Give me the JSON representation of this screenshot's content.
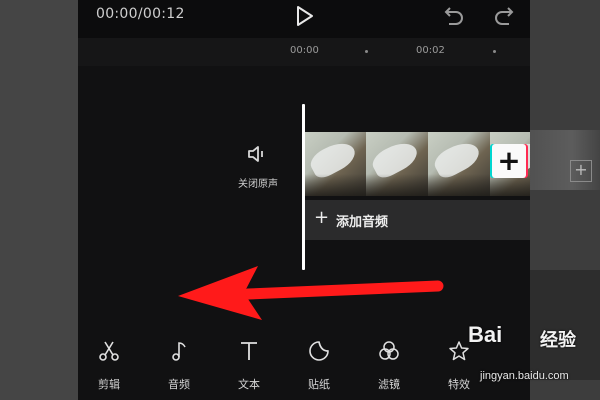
{
  "header": {
    "time": "00:00/00:12"
  },
  "ruler": {
    "labels": [
      "00:00",
      "00:02"
    ]
  },
  "track": {
    "mute_label": "关闭原声",
    "add_audio_plus": "+",
    "add_audio_label": "添加音频",
    "add_clip_symbol": "+"
  },
  "toolbar": {
    "items": [
      {
        "label": "剪辑",
        "icon": "scissors-icon"
      },
      {
        "label": "音频",
        "icon": "music-note-icon"
      },
      {
        "label": "文本",
        "icon": "text-icon"
      },
      {
        "label": "贴纸",
        "icon": "sticker-icon"
      },
      {
        "label": "滤镜",
        "icon": "filter-icon"
      },
      {
        "label": "特效",
        "icon": "effects-star-icon"
      }
    ]
  },
  "watermark": {
    "logo": "Bai",
    "title": "经验",
    "url": "jingyan.baidu.com"
  },
  "colors": {
    "arrow": "#ff1a1a",
    "app_bg": "#111112",
    "add_clip_accent_left": "#00d6d0",
    "add_clip_accent_right": "#ff2a52"
  }
}
